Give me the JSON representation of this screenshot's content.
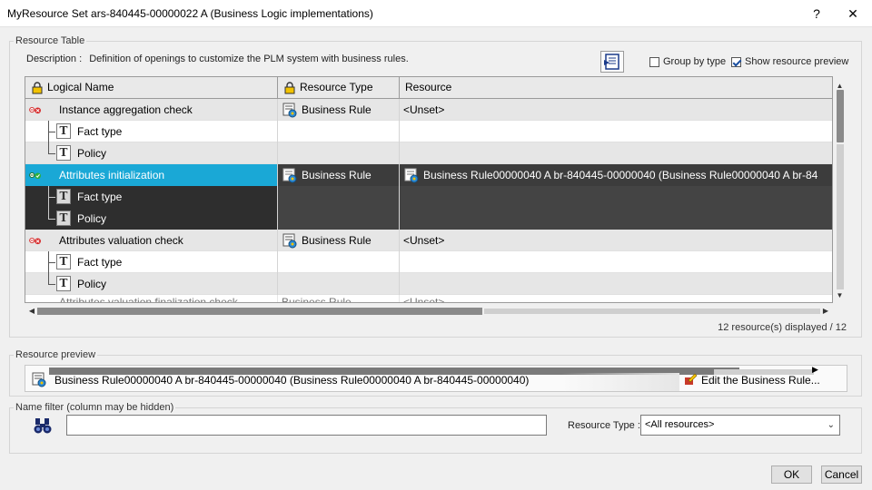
{
  "window": {
    "title": "MyResource Set ars-840445-00000022 A (Business Logic implementations)",
    "help_label": "?",
    "close_label": "✕"
  },
  "resource_table": {
    "group_label": "Resource Table",
    "description_label": "Description :",
    "description_text": "Definition of openings to customize the PLM system with business rules.",
    "group_by_type_label": "Group by type",
    "group_by_type_checked": false,
    "show_preview_label": "Show resource preview",
    "show_preview_checked": true,
    "columns": [
      "Logical Name",
      "Resource Type",
      "Resource"
    ],
    "rows": [
      {
        "name": "Instance aggregation check",
        "type": "Business Rule",
        "resource": "<Unset>"
      },
      {
        "name": "Fact type",
        "type": "",
        "resource": ""
      },
      {
        "name": "Policy",
        "type": "",
        "resource": ""
      },
      {
        "name": "Attributes initialization",
        "type": "Business Rule",
        "resource": "Business Rule00000040 A br-840445-00000040 (Business Rule00000040 A br-84"
      },
      {
        "name": "Fact type",
        "type": "",
        "resource": ""
      },
      {
        "name": "Policy",
        "type": "",
        "resource": ""
      },
      {
        "name": "Attributes valuation check",
        "type": "Business Rule",
        "resource": "<Unset>"
      },
      {
        "name": "Fact type",
        "type": "",
        "resource": ""
      },
      {
        "name": "Policy",
        "type": "",
        "resource": ""
      },
      {
        "name": "Attributes valuation finalization check",
        "type": "Business Rule",
        "resource": "<Unset>"
      }
    ],
    "count_text": "12 resource(s) displayed / 12"
  },
  "resource_preview": {
    "group_label": "Resource preview",
    "value": "Business Rule00000040 A br-840445-00000040 (Business Rule00000040 A br-840445-00000040)",
    "edit_label": "Edit the Business Rule..."
  },
  "name_filter": {
    "group_label": "Name filter (column may be hidden)",
    "input_value": "",
    "resource_type_label": "Resource Type :",
    "resource_type_value": "<All resources>"
  },
  "footer": {
    "ok_label": "OK",
    "cancel_label": "Cancel"
  },
  "colors": {
    "selection": "#1aa8d6",
    "selected_row": "#3c3c3c",
    "error_icon": "#d62828"
  }
}
